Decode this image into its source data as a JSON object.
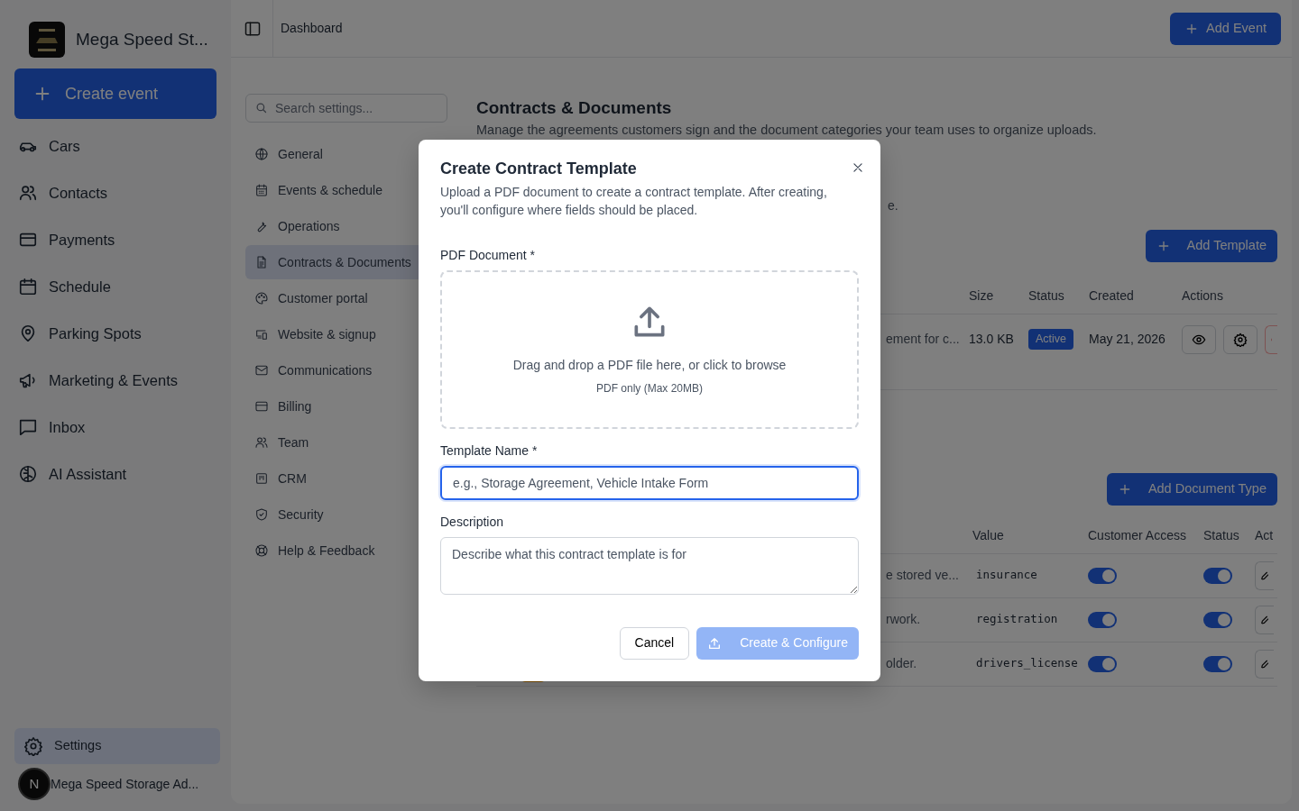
{
  "sidebar": {
    "brand": "Mega Speed St...",
    "create_button": "Create event",
    "items": [
      {
        "label": "Cars",
        "selected": false
      },
      {
        "label": "Contacts",
        "selected": false
      },
      {
        "label": "Payments",
        "selected": false
      },
      {
        "label": "Schedule",
        "selected": false
      },
      {
        "label": "Parking Spots",
        "selected": false
      },
      {
        "label": "Marketing & Events",
        "selected": false
      },
      {
        "label": "Inbox",
        "selected": false
      },
      {
        "label": "AI Assistant",
        "selected": false
      }
    ],
    "settings": {
      "label": "Settings",
      "selected": true
    },
    "user": {
      "avatar_letter": "N",
      "name": "Mega Speed Storage Ad..."
    }
  },
  "topbar": {
    "breadcrumb": "Dashboard",
    "add_button": "Add Event"
  },
  "settings_nav": {
    "search_placeholder": "Search settings...",
    "items": [
      {
        "label": "General",
        "selected": false
      },
      {
        "label": "Events & schedule",
        "selected": false
      },
      {
        "label": "Operations",
        "selected": false
      },
      {
        "label": "Contracts & Documents",
        "selected": true
      },
      {
        "label": "Customer portal",
        "selected": false
      },
      {
        "label": "Website & signup",
        "selected": false
      },
      {
        "label": "Communications",
        "selected": false
      },
      {
        "label": "Billing",
        "selected": false
      },
      {
        "label": "Team",
        "selected": false
      },
      {
        "label": "CRM",
        "selected": false
      },
      {
        "label": "Security",
        "selected": false
      },
      {
        "label": "Help & Feedback",
        "selected": false
      }
    ]
  },
  "content": {
    "title": "Contracts & Documents",
    "description": "Manage the agreements customers sign and the document categories your team uses to organize uploads.",
    "templates": {
      "fragment": "e.",
      "add_button": "Add Template",
      "columns": [
        "Size",
        "Status",
        "Created",
        "Actions"
      ],
      "rows": [
        {
          "description": "ement for c...",
          "size": "13.0 KB",
          "status": "Active",
          "created": "May 21, 2026"
        }
      ]
    },
    "document_types": {
      "add_button": "Add Document Type",
      "columns": [
        "Value",
        "Customer Access",
        "Status",
        "Act"
      ],
      "rows": [
        {
          "description": "e stored ve...",
          "value": "insurance",
          "customer_access": true,
          "active": true
        },
        {
          "description": "rwork.",
          "value": "registration",
          "customer_access": true,
          "active": true
        },
        {
          "description": "older.",
          "value": "drivers_license",
          "customer_access": true,
          "active": true
        }
      ]
    }
  },
  "modal": {
    "title": "Create Contract Template",
    "description": "Upload a PDF document to create a contract template. After creating, you'll configure where fields should be placed.",
    "pdf_label": "PDF Document *",
    "drop_text": "Drag and drop a PDF file here, or click to browse",
    "drop_hint": "PDF only (Max 20MB)",
    "name_label": "Template Name *",
    "name_placeholder": "e.g., Storage Agreement, Vehicle Intake Form",
    "name_focused": true,
    "description_label": "Description",
    "description_placeholder": "Describe what this contract template is for",
    "cancel_button": "Cancel",
    "submit_button": "Create & Configure",
    "submit_disabled": true
  }
}
